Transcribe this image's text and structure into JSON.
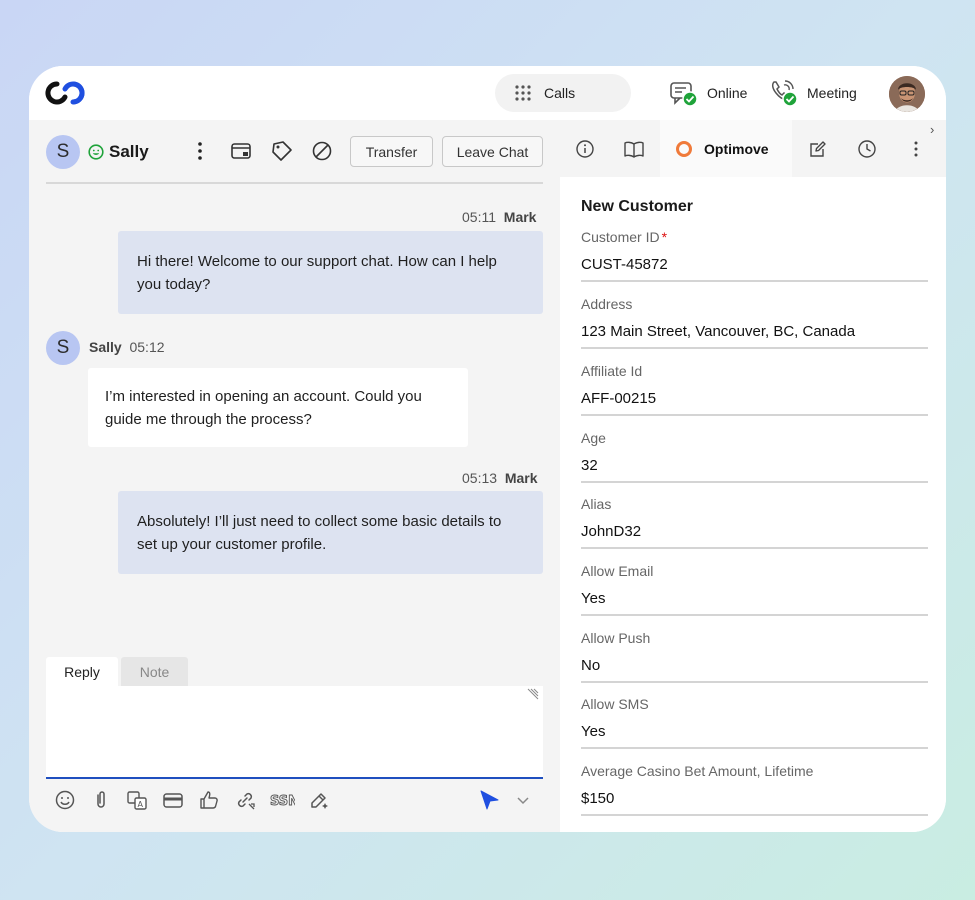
{
  "topbar": {
    "calls_label": "Calls",
    "online_label": "Online",
    "meeting_label": "Meeting",
    "accent_green": "#1fa33a",
    "icons": [
      "logo-icon",
      "dialpad-icon",
      "chat-status-icon",
      "phone-status-icon",
      "user-avatar"
    ]
  },
  "chat": {
    "avatar_letter": "S",
    "contact_name": "Sally",
    "transfer_label": "Transfer",
    "leave_label": "Leave Chat",
    "header_icons": [
      "more-vertical-icon",
      "window-icon",
      "tag-icon",
      "block-icon"
    ],
    "messages": [
      {
        "from": "agent",
        "time": "05:11",
        "author": "Mark",
        "text": "Hi there! Welcome to our support chat. How can I help you today?"
      },
      {
        "from": "customer",
        "time": "05:12",
        "author": "Sally",
        "avatar": "S",
        "text": "I’m interested in opening an account. Could you guide me through the process?"
      },
      {
        "from": "agent",
        "time": "05:13",
        "author": "Mark",
        "text": "Absolutely! I’ll just need to collect some basic details to set up your customer profile."
      }
    ],
    "agent_bubble_color": "#dde3f1"
  },
  "composer": {
    "tab_reply": "Reply",
    "tab_note": "Note",
    "accent_blue": "#1f4fbf",
    "toolbar_icons": [
      "emoji-icon",
      "attachment-icon",
      "translate-icon",
      "card-icon",
      "thumbs-up-icon",
      "link-icon",
      "ssn-icon",
      "magic-pen-icon",
      "send-icon",
      "chevron-down-icon"
    ]
  },
  "side": {
    "tab_icons": [
      "info-icon",
      "book-icon",
      "edit-icon",
      "history-icon",
      "more-vertical-icon"
    ],
    "active_tab": "Optimove",
    "optimove_color": "#f07a3a",
    "form_title": "New Customer",
    "fields": [
      {
        "label": "Customer ID",
        "required": "*",
        "value": "CUST-45872"
      },
      {
        "label": "Address",
        "value": "123 Main Street, Vancouver, BC, Canada"
      },
      {
        "label": "Affiliate Id",
        "value": "AFF-00215"
      },
      {
        "label": "Age",
        "value": "32"
      },
      {
        "label": "Alias",
        "value": "JohnD32"
      },
      {
        "label": "Allow Email",
        "value": "Yes"
      },
      {
        "label": "Allow Push",
        "value": "No"
      },
      {
        "label": "Allow SMS",
        "value": "Yes"
      },
      {
        "label": "Average Casino Bet Amount, Lifetime",
        "value": "$150"
      }
    ]
  }
}
